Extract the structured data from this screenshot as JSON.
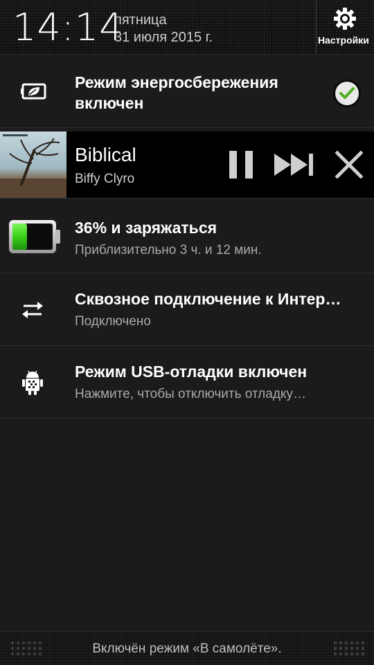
{
  "header": {
    "time": "14:14",
    "day": "пятница",
    "date": "31 июля 2015 г.",
    "settings_label": "Настройки"
  },
  "notifications": {
    "power_saving": {
      "title_line1": "Режим энергосбережения",
      "title_line2": "включен",
      "icon": "battery-leaf-icon",
      "enabled": true
    },
    "media": {
      "song": "Biblical",
      "artist": "Biffy Clyro",
      "controls": [
        "pause-icon",
        "skip-next-icon",
        "close-icon"
      ]
    },
    "battery": {
      "title": "36% и заряжаться",
      "subtitle": "Приблизительно 3 ч. и 12 мин.",
      "level_percent": 36,
      "fill_color": "#39d21a"
    },
    "tethering": {
      "title": "Сквозное подключение к Интер…",
      "subtitle": "Подключено",
      "icon": "transfer-arrows-icon"
    },
    "usb_debug": {
      "title": "Режим USB-отладки включен",
      "subtitle": "Нажмите, чтобы отключить отладку…",
      "icon": "android-debug-icon"
    }
  },
  "footer": {
    "status_text": "Включён режим «В самолёте»."
  }
}
